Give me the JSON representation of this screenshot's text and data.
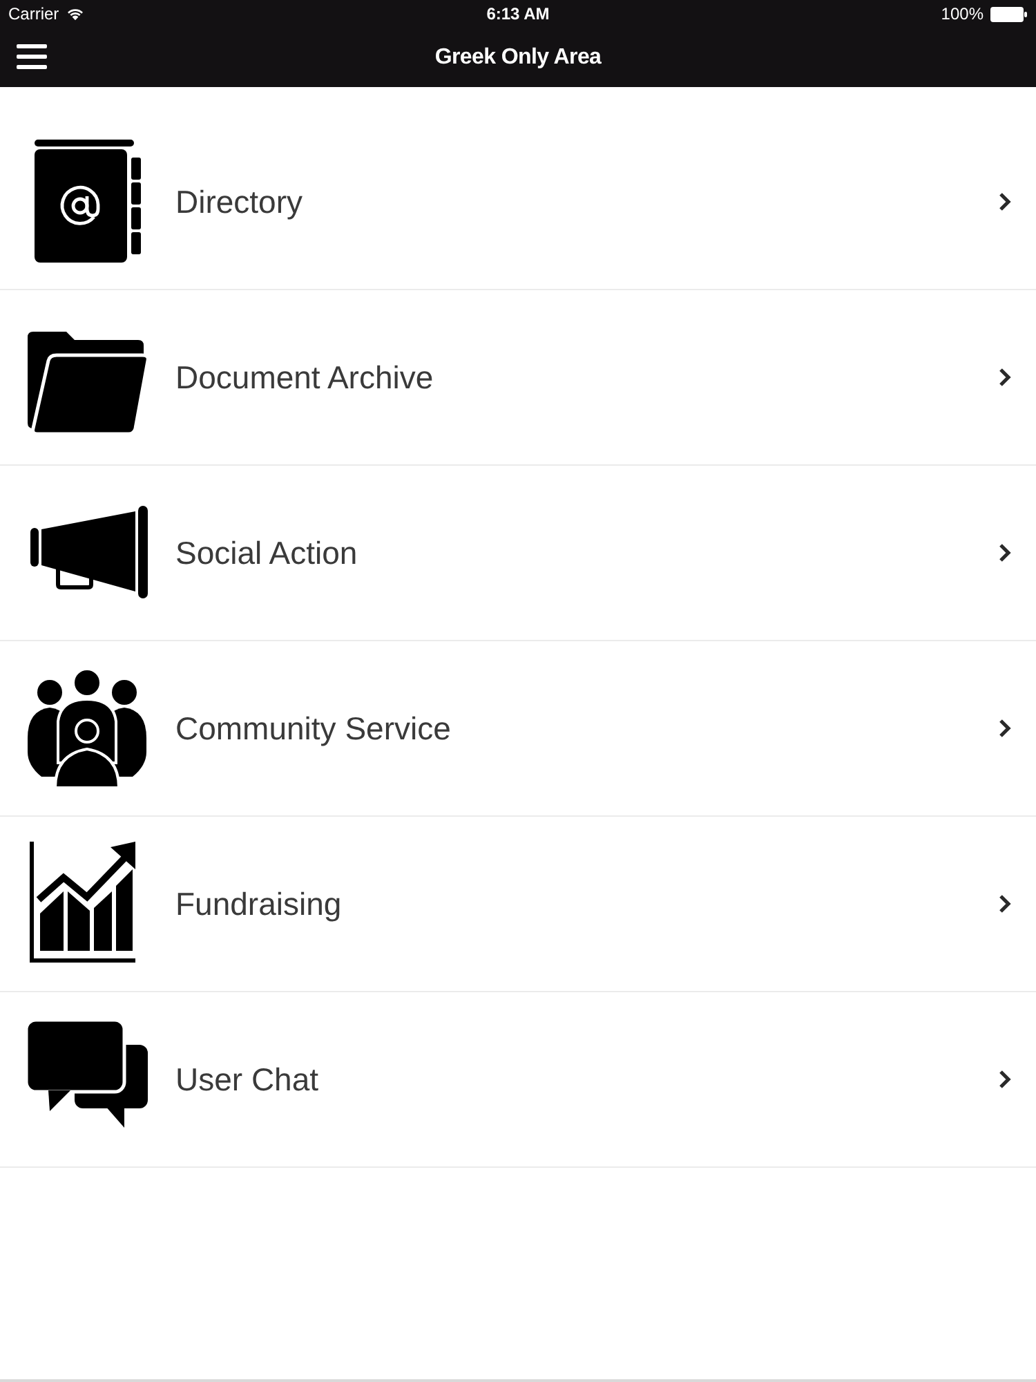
{
  "status_bar": {
    "carrier": "Carrier",
    "time": "6:13 AM",
    "battery": "100%"
  },
  "nav_bar": {
    "title": "Greek Only Area"
  },
  "menu": {
    "items": [
      {
        "label": "Directory"
      },
      {
        "label": "Document Archive"
      },
      {
        "label": "Social Action"
      },
      {
        "label": "Community Service"
      },
      {
        "label": "Fundraising"
      },
      {
        "label": "User Chat"
      }
    ]
  }
}
